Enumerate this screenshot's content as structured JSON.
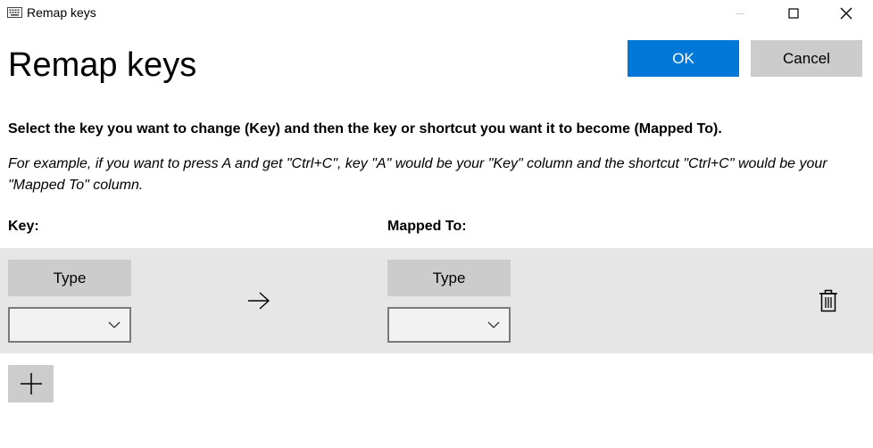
{
  "window": {
    "title": "Remap keys",
    "icons": {
      "app": "keyboard-icon",
      "minimize": "minimize-icon",
      "maximize": "maximize-icon",
      "close": "close-icon"
    }
  },
  "header": {
    "title": "Remap keys",
    "ok_label": "OK",
    "cancel_label": "Cancel"
  },
  "instructions": {
    "main": "Select the key you want to change (Key) and then the key or shortcut you want it to become (Mapped To).",
    "example": "For example, if you want to press A and get \"Ctrl+C\", key \"A\" would be your \"Key\" column and the shortcut \"Ctrl+C\" would be your \"Mapped To\" column."
  },
  "columns": {
    "key": "Key:",
    "mapped_to": "Mapped To:"
  },
  "rows": [
    {
      "key": {
        "type_label": "Type",
        "selected": ""
      },
      "mapped": {
        "type_label": "Type",
        "selected": ""
      }
    }
  ],
  "colors": {
    "accent": "#0078d7",
    "button_gray": "#cccccc",
    "row_background": "#e6e6e6"
  }
}
